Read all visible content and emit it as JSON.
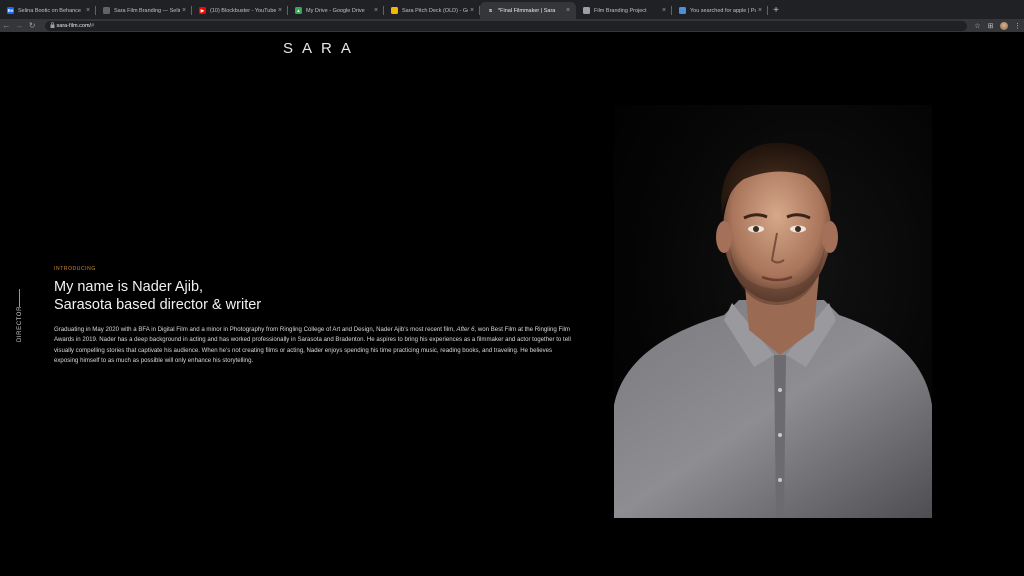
{
  "browser": {
    "tabs": [
      {
        "title": "Selina Bootic on Behance",
        "favicon": "Be",
        "color": "#1769ff",
        "active": false
      },
      {
        "title": "Sara Film Branding — Selina B",
        "favicon": "",
        "color": "#5f6368",
        "active": false
      },
      {
        "title": "(10) Blockbuster - YouTube",
        "favicon": "▶",
        "color": "#ff0000",
        "active": false
      },
      {
        "title": "My Drive - Google Drive",
        "favicon": "▲",
        "color": "#34a853",
        "active": false
      },
      {
        "title": "Sara Pitch Deck (OLD) - Goog",
        "favicon": "",
        "color": "#f4b400",
        "active": false
      },
      {
        "title": "*Final Filmmaker | Sara",
        "favicon": "S",
        "color": "#35363a",
        "active": true
      },
      {
        "title": "Film Branding Project",
        "favicon": "",
        "color": "#9aa0a6",
        "active": false
      },
      {
        "title": "You searched for apple | Page",
        "favicon": "",
        "color": "#4a90e2",
        "active": false
      }
    ],
    "url": "sara-film.com/",
    "url_hash": "#",
    "icons": {
      "back": "←",
      "forward": "→",
      "reload": "↻",
      "star": "☆",
      "extension": "⊞",
      "menu": "⋮",
      "newtab": "+",
      "close": "×",
      "lock": "🔒"
    }
  },
  "site": {
    "logo": "SARA",
    "side_label": "DIRECTOR",
    "eyebrow": "INTRODUCING",
    "headline_line1": "My name is Nader Ajib,",
    "headline_line2": "Sarasota based director & writer",
    "bio_part1": "Graduating in May 2020 with a BFA in Digital Film and a minor in Photography from Ringling College of Art and Design, Nader Ajib's most recent film, ",
    "bio_film": "After 6",
    "bio_part2": ", won Best Film at the Ringling Film Awards in 2019. Nader has a deep background in acting and has worked professionally in Sarasota and Bradenton. He aspires to bring his experiences as a filmmaker and actor together to tell visually compelling stories that captivate his audience. When he's not creating films or acting, Nader enjoys spending his time practicing music, reading books, and traveling. He believes exposing himself to as much as possible will only enhance his storytelling.",
    "accent_color": "#d08a3a"
  }
}
